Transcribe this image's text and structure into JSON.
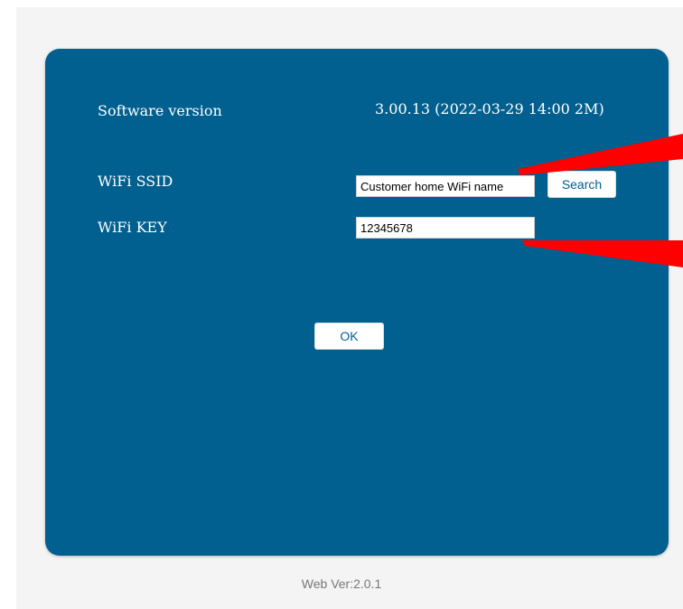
{
  "info": {
    "software_version_label": "Software version",
    "software_version_value": "3.00.13 (2022-03-29 14:00 2M)"
  },
  "wifi": {
    "ssid_label": "WiFi SSID",
    "ssid_value": "Customer home WiFi name",
    "search_label": "Search",
    "key_label": "WiFi KEY",
    "key_value": "12345678"
  },
  "actions": {
    "ok_label": "OK"
  },
  "footer": {
    "web_version": "Web Ver:2.0.1"
  },
  "colors": {
    "panel": "#01608f",
    "annotation_arrow": "#ff0000"
  }
}
